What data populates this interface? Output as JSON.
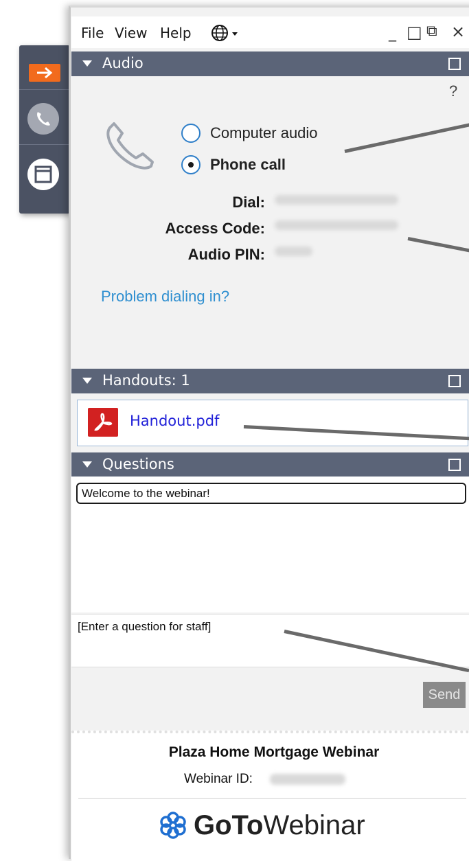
{
  "menubar": {
    "items": [
      "File",
      "View",
      "Help"
    ],
    "window_controls": [
      "_",
      "□",
      "⧉",
      "×"
    ]
  },
  "audio": {
    "section_title": "Audio",
    "help": "?",
    "options": [
      {
        "label": "Computer audio",
        "selected": false
      },
      {
        "label": "Phone call",
        "selected": true
      }
    ],
    "dial_label": "Dial:",
    "access_code_label": "Access Code:",
    "audio_pin_label": "Audio PIN:",
    "problem_link": "Problem dialing in?"
  },
  "handouts": {
    "section_title": "Handouts: 1",
    "files": [
      "Handout.pdf"
    ]
  },
  "questions": {
    "section_title": "Questions",
    "messages": [
      "Welcome to the webinar!"
    ],
    "input_placeholder": "[Enter a question for staff]",
    "send_label": "Send"
  },
  "footer": {
    "webinar_title": "Plaza Home Mortgage Webinar",
    "webinar_id_label": "Webinar ID:",
    "brand_goto": "GoTo",
    "brand_webinar": "Webinar"
  },
  "colors": {
    "section_header": "#5b6478",
    "accent_orange": "#f26b1d",
    "link_blue": "#2f8fd0",
    "pdf_red": "#d22121",
    "brand_blue": "#1f6fd1"
  }
}
